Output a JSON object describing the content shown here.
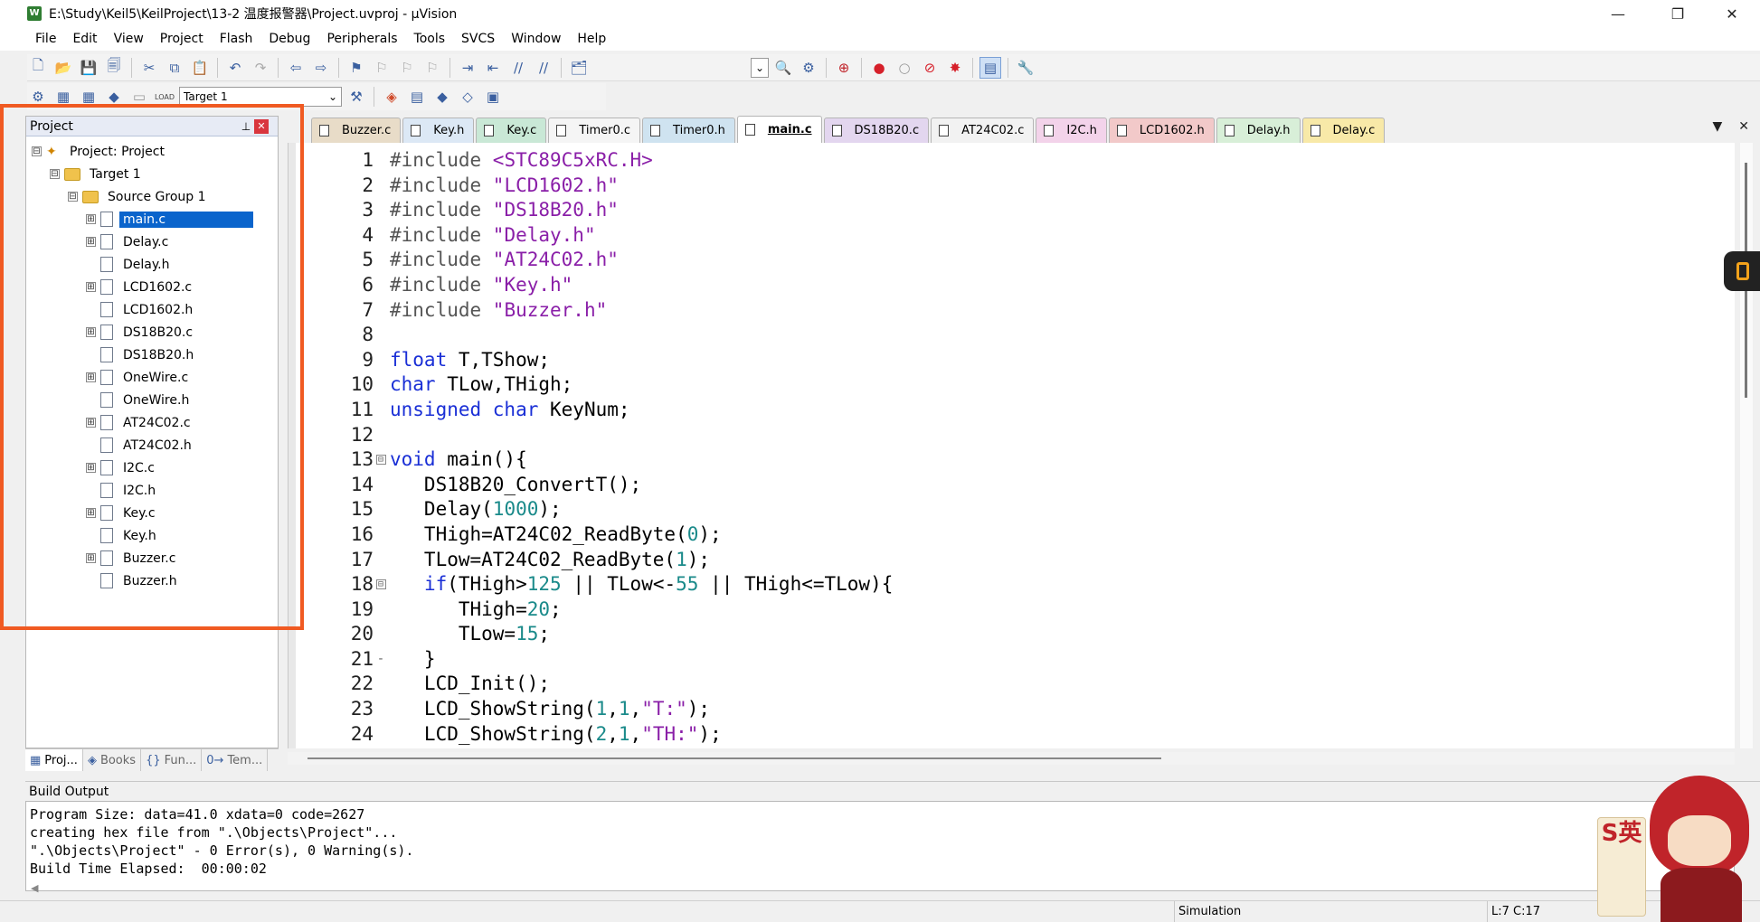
{
  "window": {
    "title": "E:\\Study\\Keil5\\KeilProject\\13-2 温度报警器\\Project.uvproj - µVision",
    "controls": [
      "—",
      "❐",
      "✕"
    ]
  },
  "menu": [
    "File",
    "Edit",
    "View",
    "Project",
    "Flash",
    "Debug",
    "Peripherals",
    "Tools",
    "SVCS",
    "Window",
    "Help"
  ],
  "toolbar": {
    "target_label": "Target 1",
    "load_label": "LOAD"
  },
  "project_panel": {
    "title": "Project",
    "pin": "📌",
    "close": "✕",
    "tree": [
      {
        "level": 0,
        "expander": "⊟",
        "icon": "project",
        "label": "Project: Project",
        "selected": false
      },
      {
        "level": 1,
        "expander": "⊟",
        "icon": "folder",
        "label": "Target 1",
        "selected": false
      },
      {
        "level": 2,
        "expander": "⊟",
        "icon": "folder",
        "label": "Source Group 1",
        "selected": false
      },
      {
        "level": 3,
        "expander": "⊞",
        "icon": "file",
        "label": "main.c",
        "selected": true
      },
      {
        "level": 3,
        "expander": "⊞",
        "icon": "file",
        "label": "Delay.c",
        "selected": false
      },
      {
        "level": 3,
        "expander": "",
        "icon": "file",
        "label": "Delay.h",
        "selected": false
      },
      {
        "level": 3,
        "expander": "⊞",
        "icon": "file",
        "label": "LCD1602.c",
        "selected": false
      },
      {
        "level": 3,
        "expander": "",
        "icon": "file",
        "label": "LCD1602.h",
        "selected": false
      },
      {
        "level": 3,
        "expander": "⊞",
        "icon": "file",
        "label": "DS18B20.c",
        "selected": false
      },
      {
        "level": 3,
        "expander": "",
        "icon": "file",
        "label": "DS18B20.h",
        "selected": false
      },
      {
        "level": 3,
        "expander": "⊞",
        "icon": "file",
        "label": "OneWire.c",
        "selected": false
      },
      {
        "level": 3,
        "expander": "",
        "icon": "file",
        "label": "OneWire.h",
        "selected": false
      },
      {
        "level": 3,
        "expander": "⊞",
        "icon": "file",
        "label": "AT24C02.c",
        "selected": false
      },
      {
        "level": 3,
        "expander": "",
        "icon": "file",
        "label": "AT24C02.h",
        "selected": false
      },
      {
        "level": 3,
        "expander": "⊞",
        "icon": "file",
        "label": "I2C.c",
        "selected": false
      },
      {
        "level": 3,
        "expander": "",
        "icon": "file",
        "label": "I2C.h",
        "selected": false
      },
      {
        "level": 3,
        "expander": "⊞",
        "icon": "file",
        "label": "Key.c",
        "selected": false
      },
      {
        "level": 3,
        "expander": "",
        "icon": "file",
        "label": "Key.h",
        "selected": false
      },
      {
        "level": 3,
        "expander": "⊞",
        "icon": "file",
        "label": "Buzzer.c",
        "selected": false
      },
      {
        "level": 3,
        "expander": "",
        "icon": "file",
        "label": "Buzzer.h",
        "selected": false
      }
    ],
    "bottom_tabs": [
      {
        "icon": "▦",
        "label": "Proj...",
        "active": true
      },
      {
        "icon": "◈",
        "label": "Books",
        "active": false
      },
      {
        "icon": "{}",
        "label": "Fun...",
        "active": false
      },
      {
        "icon": "0→",
        "label": "Tem...",
        "active": false
      }
    ]
  },
  "editor_tabs": [
    {
      "label": "Buzzer.c",
      "color": "#e8dcc8",
      "active": false
    },
    {
      "label": "Key.h",
      "color": "#dce8f5",
      "active": false
    },
    {
      "label": "Key.c",
      "color": "#c9e8d6",
      "active": false
    },
    {
      "label": "Timer0.c",
      "color": "#f5f5f5",
      "active": false
    },
    {
      "label": "Timer0.h",
      "color": "#cfe3f0",
      "active": false
    },
    {
      "label": "main.c",
      "color": "#ffffff",
      "active": true
    },
    {
      "label": "DS18B20.c",
      "color": "#e3d6ef",
      "active": false
    },
    {
      "label": "AT24C02.c",
      "color": "#f2f2f2",
      "active": false
    },
    {
      "label": "I2C.h",
      "color": "#f3d3ea",
      "active": false
    },
    {
      "label": "LCD1602.h",
      "color": "#f2c9c9",
      "active": false
    },
    {
      "label": "Delay.h",
      "color": "#d8efd8",
      "active": false
    },
    {
      "label": "Delay.c",
      "color": "#f8e9a8",
      "active": false
    }
  ],
  "tabs_controls": [
    "▼",
    "✕"
  ],
  "code": [
    {
      "n": "1",
      "fold": "",
      "tokens": [
        [
          "pp",
          "#include "
        ],
        [
          "str",
          "<STC89C5xRC.H>"
        ]
      ]
    },
    {
      "n": "2",
      "fold": "",
      "tokens": [
        [
          "pp",
          "#include "
        ],
        [
          "str",
          "\"LCD1602.h\""
        ]
      ]
    },
    {
      "n": "3",
      "fold": "",
      "tokens": [
        [
          "pp",
          "#include "
        ],
        [
          "str",
          "\"DS18B20.h\""
        ]
      ]
    },
    {
      "n": "4",
      "fold": "",
      "tokens": [
        [
          "pp",
          "#include "
        ],
        [
          "str",
          "\"Delay.h\""
        ]
      ]
    },
    {
      "n": "5",
      "fold": "",
      "tokens": [
        [
          "pp",
          "#include "
        ],
        [
          "str",
          "\"AT24C02.h\""
        ]
      ]
    },
    {
      "n": "6",
      "fold": "",
      "tokens": [
        [
          "pp",
          "#include "
        ],
        [
          "str",
          "\"Key.h\""
        ]
      ]
    },
    {
      "n": "7",
      "fold": "",
      "tokens": [
        [
          "pp",
          "#include "
        ],
        [
          "str",
          "\"Buzzer.h\""
        ]
      ]
    },
    {
      "n": "8",
      "fold": "",
      "tokens": []
    },
    {
      "n": "9",
      "fold": "",
      "tokens": [
        [
          "kw",
          "float"
        ],
        [
          "plain",
          " T,TShow;"
        ]
      ]
    },
    {
      "n": "10",
      "fold": "",
      "tokens": [
        [
          "kw",
          "char"
        ],
        [
          "plain",
          " TLow,THigh;"
        ]
      ]
    },
    {
      "n": "11",
      "fold": "",
      "tokens": [
        [
          "kw",
          "unsigned char"
        ],
        [
          "plain",
          " KeyNum;"
        ]
      ]
    },
    {
      "n": "12",
      "fold": "",
      "tokens": []
    },
    {
      "n": "13",
      "fold": "⊟",
      "tokens": [
        [
          "kw",
          "void"
        ],
        [
          "plain",
          " main(){"
        ]
      ]
    },
    {
      "n": "14",
      "fold": "",
      "tokens": [
        [
          "plain",
          "   DS18B20_ConvertT();"
        ]
      ]
    },
    {
      "n": "15",
      "fold": "",
      "tokens": [
        [
          "plain",
          "   Delay("
        ],
        [
          "num",
          "1000"
        ],
        [
          "plain",
          ");"
        ]
      ]
    },
    {
      "n": "16",
      "fold": "",
      "tokens": [
        [
          "plain",
          "   THigh=AT24C02_ReadByte("
        ],
        [
          "num",
          "0"
        ],
        [
          "plain",
          ");"
        ]
      ]
    },
    {
      "n": "17",
      "fold": "",
      "tokens": [
        [
          "plain",
          "   TLow=AT24C02_ReadByte("
        ],
        [
          "num",
          "1"
        ],
        [
          "plain",
          ");"
        ]
      ]
    },
    {
      "n": "18",
      "fold": "⊟",
      "tokens": [
        [
          "plain",
          "   "
        ],
        [
          "kw",
          "if"
        ],
        [
          "plain",
          "(THigh>"
        ],
        [
          "num",
          "125"
        ],
        [
          "plain",
          " || TLow<-"
        ],
        [
          "num",
          "55"
        ],
        [
          "plain",
          " || THigh<=TLow){"
        ]
      ]
    },
    {
      "n": "19",
      "fold": "",
      "tokens": [
        [
          "plain",
          "      THigh="
        ],
        [
          "num",
          "20"
        ],
        [
          "plain",
          ";"
        ]
      ]
    },
    {
      "n": "20",
      "fold": "",
      "tokens": [
        [
          "plain",
          "      TLow="
        ],
        [
          "num",
          "15"
        ],
        [
          "plain",
          ";"
        ]
      ]
    },
    {
      "n": "21",
      "fold": "-",
      "tokens": [
        [
          "plain",
          "   }"
        ]
      ]
    },
    {
      "n": "22",
      "fold": "",
      "tokens": [
        [
          "plain",
          "   LCD_Init();"
        ]
      ]
    },
    {
      "n": "23",
      "fold": "",
      "tokens": [
        [
          "plain",
          "   LCD_ShowString("
        ],
        [
          "num",
          "1"
        ],
        [
          "plain",
          ","
        ],
        [
          "num",
          "1"
        ],
        [
          "plain",
          ","
        ],
        [
          "str",
          "\"T:\""
        ],
        [
          "plain",
          ");"
        ]
      ]
    },
    {
      "n": "24",
      "fold": "",
      "tokens": [
        [
          "plain",
          "   LCD_ShowString("
        ],
        [
          "num",
          "2"
        ],
        [
          "plain",
          ","
        ],
        [
          "num",
          "1"
        ],
        [
          "plain",
          ","
        ],
        [
          "str",
          "\"TH:\""
        ],
        [
          "plain",
          ");"
        ]
      ]
    }
  ],
  "build": {
    "title": "Build Output",
    "lines": [
      "Program Size: data=41.0 xdata=0 code=2627",
      "creating hex file from \".\\Objects\\Project\"...",
      "\".\\Objects\\Project\" - 0 Error(s), 0 Warning(s).",
      "Build Time Elapsed:  00:00:02"
    ]
  },
  "status": {
    "mode": "Simulation",
    "position": "L:7 C:17"
  },
  "colors": {
    "highlight": "#f05a22",
    "selection": "#0a64cc",
    "keyword": "#1a2fd6",
    "string": "#8a1fa8",
    "number": "#1a8a8a"
  },
  "mascot": {
    "badge_text": "S英"
  }
}
